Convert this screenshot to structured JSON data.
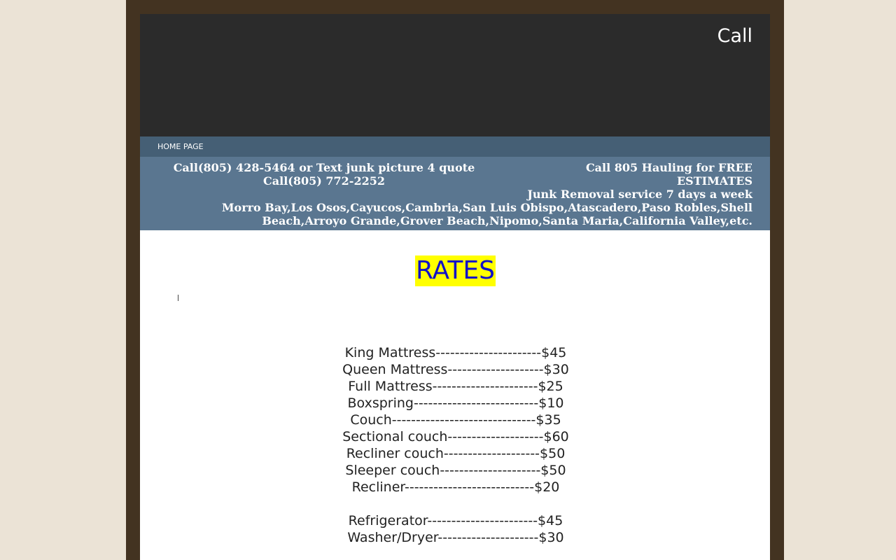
{
  "header": {
    "call_text": "Call"
  },
  "nav": {
    "home_label": "HOME PAGE"
  },
  "info": {
    "left_line1": "Call(805) 428-5464  or Text junk picture 4 quote",
    "left_line2": "Call(805) 772-2252",
    "right_line1": "Call 805 Hauling for FREE ESTIMATES",
    "right_line2": "Junk Removal service 7 days a week",
    "towns": "Morro Bay,Los Osos,Cayucos,Cambria,San Luis Obispo,Atascadero,Paso Robles,Shell Beach,Arroyo Grande,Grover Beach,Nipomo,Santa Maria,California Valley,etc."
  },
  "rates": {
    "title": "RATES",
    "items": [
      "King Mattress----------------------$45",
      "Queen Mattress--------------------$30",
      "Full Mattress----------------------$25",
      "Boxspring--------------------------$10",
      "Couch------------------------------$35",
      "Sectional couch--------------------$60",
      "Recliner couch--------------------$50",
      "Sleeper couch---------------------$50",
      "Recliner---------------------------$20",
      "",
      "Refrigerator-----------------------$45",
      "Washer/Dryer---------------------$30"
    ]
  },
  "colors": {
    "outer_background": "#ebe3d6",
    "frame": "#433321",
    "header": "#2b2b2b",
    "navbar": "#455f75",
    "infobar": "#5a7690",
    "title_highlight": "#ffff00",
    "title_text": "#1212c8"
  }
}
